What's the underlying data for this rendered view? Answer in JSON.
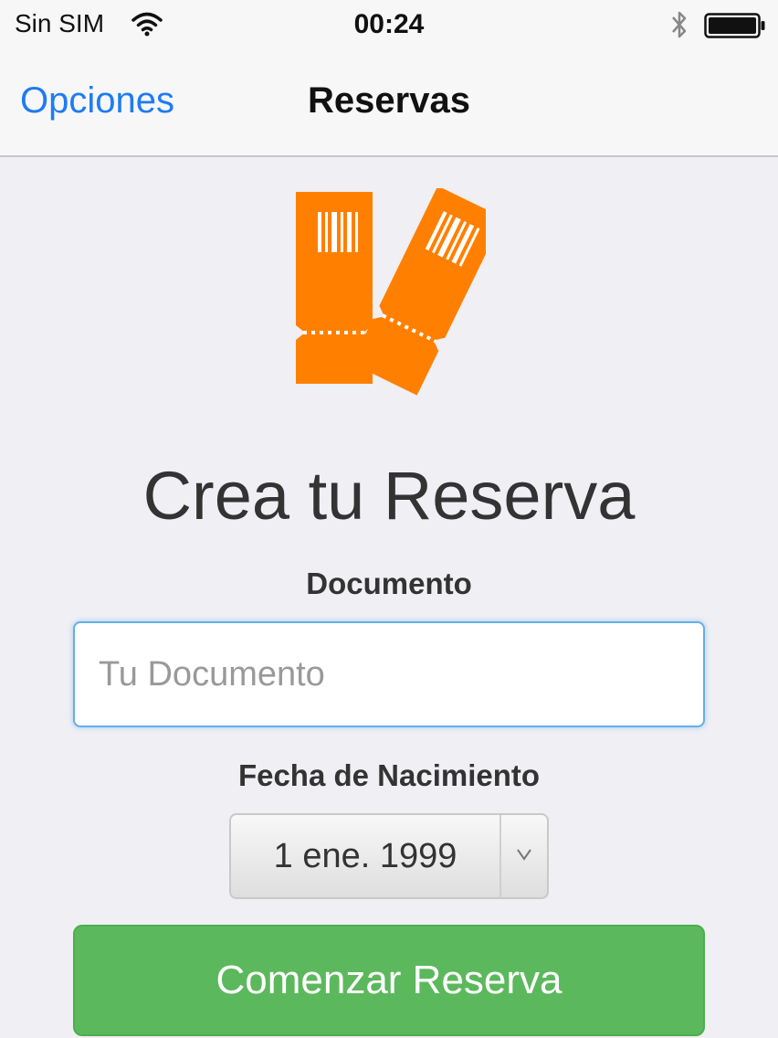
{
  "status_bar": {
    "carrier": "Sin SIM",
    "time": "00:24",
    "icons": [
      "wifi-icon",
      "bluetooth-icon",
      "battery-icon"
    ]
  },
  "nav": {
    "back_label": "Opciones",
    "title": "Reservas"
  },
  "hero": {
    "icon": "tickets-icon",
    "heading": "Crea tu Reserva"
  },
  "form": {
    "document_label": "Documento",
    "document_placeholder": "Tu Documento",
    "document_value": "",
    "birthdate_label": "Fecha de Nacimiento",
    "birthdate_value": "1 ene. 1999",
    "submit_label": "Comenzar Reserva"
  },
  "colors": {
    "accent_blue": "#1e7cf2",
    "ticket_orange": "#ff8000",
    "button_green": "#5cb85c",
    "background": "#efeff4"
  }
}
